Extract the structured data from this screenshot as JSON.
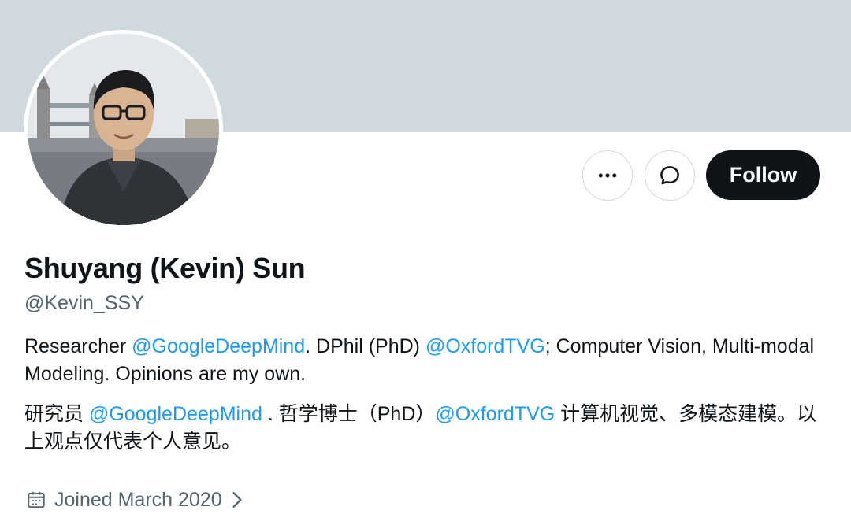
{
  "profile": {
    "display_name": "Shuyang (Kevin) Sun",
    "handle": "@Kevin_SSY",
    "bio_en": {
      "t1": "Researcher ",
      "m1": "@GoogleDeepMind",
      "t2": ". DPhil (PhD) ",
      "m2": "@OxfordTVG",
      "t3": "; Computer Vision, Multi-modal Modeling. Opinions are my own."
    },
    "bio_zh": {
      "t1": "研究员 ",
      "m1": "@GoogleDeepMind",
      "t2": " . 哲学博士（PhD）",
      "m2": "@OxfordTVG",
      "t3": " 计算机视觉、多模态建模。以上观点仅代表个人意见。"
    },
    "joined": "Joined March 2020"
  },
  "actions": {
    "follow_label": "Follow",
    "more_icon": "more-dots-icon",
    "message_icon": "message-bubble-icon"
  },
  "colors": {
    "banner": "#cfd9de",
    "mention": "#1d9bf0",
    "follow_bg": "#0f1419",
    "secondary_text": "#536471"
  }
}
